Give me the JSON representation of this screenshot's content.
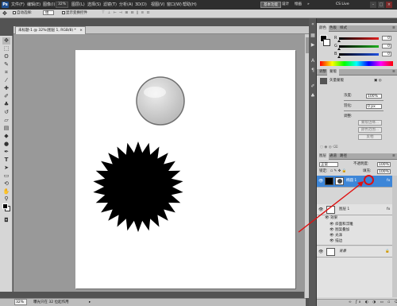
{
  "menubar": {
    "logo": "Ps",
    "items": [
      "文件(F)",
      "编辑(E)",
      "图像(I)",
      "图层(L)",
      "选择(S)",
      "滤镜(T)",
      "分析(A)",
      "3D(D)",
      "视图(V)",
      "窗口(W)",
      "帮助(H)"
    ],
    "zoom": "32%",
    "workspace_active": "基本功能",
    "workspace_design": "设计",
    "workspace_paint": "绘画",
    "more": "»",
    "cslive": "CS Live",
    "win_min": "–",
    "win_max": "□",
    "win_close": "×"
  },
  "options_bar": {
    "auto_select": "自动选择:",
    "group_value": "组",
    "show_transform": "显示变换控件"
  },
  "document": {
    "tab_title": "未标题-1 @ 32%(图层 1, RGB/8) *",
    "close": "×",
    "shapes": {
      "circle_fill_top": "#f2f2f2",
      "circle_fill_bottom": "#b9b9b9",
      "circle_stroke": "#707070",
      "starburst_fill": "#000000"
    }
  },
  "status_bar": {
    "zoom": "32%",
    "doc_info": "曝光只在 32 位起作用"
  },
  "color_panel": {
    "tabs": [
      "颜色",
      "色板",
      "样式"
    ],
    "sliders": [
      {
        "label": "R",
        "value": "0",
        "color": "#e02020"
      },
      {
        "label": "G",
        "value": "0",
        "color": "#20b020"
      },
      {
        "label": "B",
        "value": "0",
        "color": "#2050e0"
      }
    ]
  },
  "adjust_panel": {
    "tabs": [
      "调整",
      "蒙版"
    ],
    "mode": "矢量蒙版",
    "density_label": "浓度:",
    "density_value": "100%",
    "feather_label": "羽化:",
    "feather_value": "0 px",
    "refine_label": "调整:",
    "btn_edge": "蒙版边缘...",
    "btn_range": "颜色范围...",
    "btn_invert": "反相"
  },
  "layers_panel": {
    "tabs": [
      "图层",
      "通道",
      "路径"
    ],
    "blend_mode": "正常",
    "opacity_label": "不透明度:",
    "opacity_value": "100%",
    "lock_label": "锁定:",
    "fill_label": "填充:",
    "fill_value": "100%",
    "layers": [
      {
        "name": "椭圆 1",
        "selected": true
      },
      {
        "name": "图层 1",
        "selected": false
      },
      {
        "name": "背景",
        "selected": false
      }
    ],
    "fx": "fx",
    "effects_label": "效果",
    "effects": [
      "斜面和浮雕",
      "图案叠加",
      "光泽",
      "描边"
    ]
  },
  "accent_colors": {
    "selection_blue": "#3d86d8",
    "annotation_red": "#e01010"
  }
}
